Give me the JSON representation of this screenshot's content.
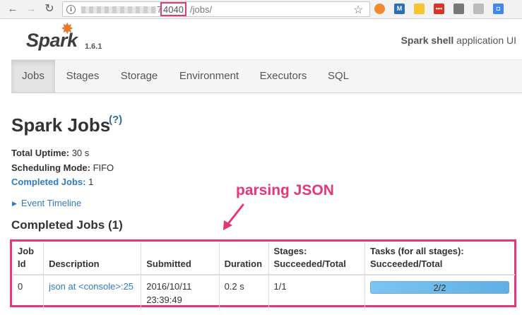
{
  "browser": {
    "url_digit": "7",
    "url_port": "4040",
    "url_path": "/jobs/",
    "extensions": [
      "M",
      "",
      "",
      "•••",
      "",
      "",
      "◘"
    ]
  },
  "header": {
    "logo_text": "Spark",
    "version": "1.6.1",
    "app_name": "Spark shell",
    "app_suffix": " application UI"
  },
  "nav": {
    "tabs": [
      "Jobs",
      "Stages",
      "Storage",
      "Environment",
      "Executors",
      "SQL"
    ],
    "active": "Jobs"
  },
  "page": {
    "title": "Spark Jobs",
    "help": "(?)",
    "uptime_label": "Total Uptime:",
    "uptime_value": " 30 s",
    "mode_label": "Scheduling Mode:",
    "mode_value": " FIFO",
    "completed_label": "Completed Jobs:",
    "completed_value": " 1",
    "event_timeline": "Event Timeline",
    "section_title": "Completed Jobs (1)"
  },
  "annotation": {
    "text": "parsing JSON",
    "color": "#e8347a"
  },
  "table": {
    "columns": [
      [
        "Job",
        "Id"
      ],
      [
        "",
        "Description"
      ],
      [
        "",
        "Submitted"
      ],
      [
        "",
        "Duration"
      ],
      [
        "Stages:",
        "Succeeded/Total"
      ],
      [
        "Tasks (for all stages):",
        "Succeeded/Total"
      ]
    ],
    "rows": [
      {
        "job_id": "0",
        "description": "json at <console>:25",
        "submitted_date": "2016/10/11",
        "submitted_time": "23:39:49",
        "duration": "0.2 s",
        "stages": "1/1",
        "tasks": "2/2",
        "tasks_progress": 1.0
      }
    ]
  }
}
